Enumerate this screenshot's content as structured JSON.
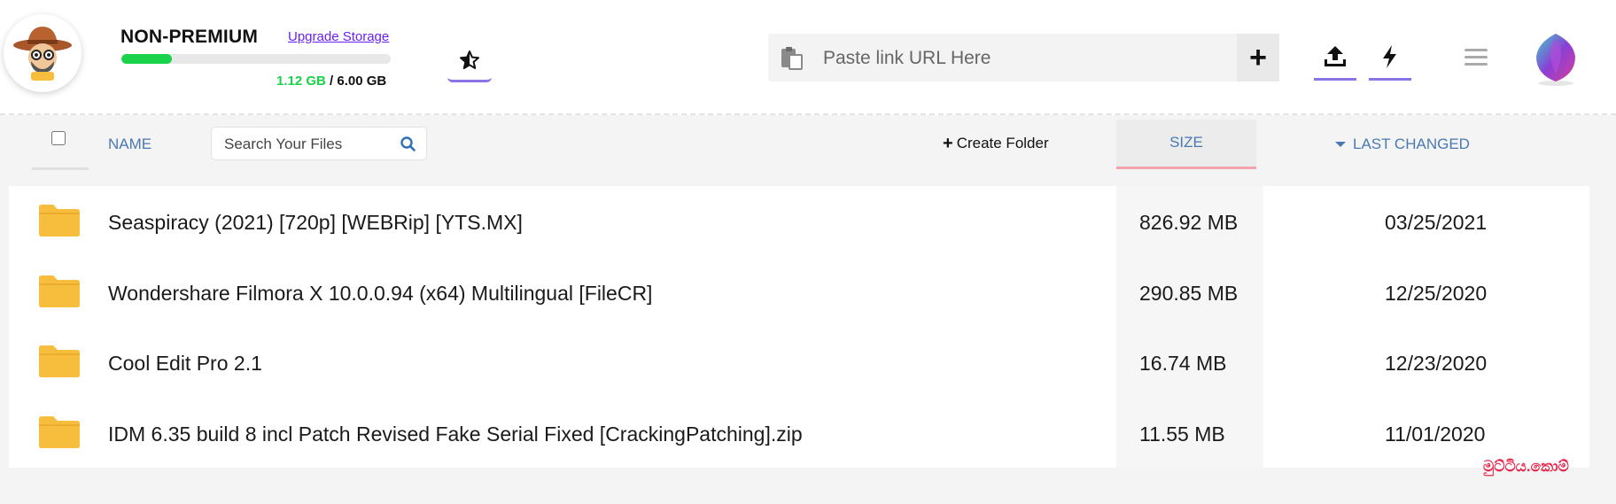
{
  "header": {
    "plan_label": "NON-PREMIUM",
    "upgrade_label": "Upgrade Storage",
    "storage_used": "1.12 GB",
    "storage_total": " / 6.00 GB",
    "storage_fraction": 0.187,
    "url_placeholder": "Paste link URL Here",
    "add_label": "+",
    "icons": [
      "user-avatar-icon",
      "star-icon",
      "clipboard-icon",
      "plus-icon",
      "upload-icon",
      "lightning-icon",
      "menu-icon",
      "logo-icon"
    ]
  },
  "toolbar": {
    "name_label": "NAME",
    "search_placeholder": "Search Your Files",
    "create_folder_label": "Create Folder",
    "size_label": "SIZE",
    "last_changed_label": "LAST CHANGED"
  },
  "files": [
    {
      "name": "Seaspiracy (2021) [720p] [WEBRip] [YTS.MX]",
      "size": "826.92 MB",
      "date": "03/25/2021"
    },
    {
      "name": "Wondershare Filmora X 10.0.0.94 (x64) Multilingual [FileCR]",
      "size": "290.85 MB",
      "date": "12/25/2020"
    },
    {
      "name": "Cool Edit Pro 2.1",
      "size": "16.74 MB",
      "date": "12/23/2020"
    },
    {
      "name": "IDM 6.35 build 8 incl Patch Revised Fake Serial Fixed [CrackingPatching].zip",
      "size": "11.55 MB",
      "date": "11/01/2020"
    }
  ],
  "watermark": "මුට්ටිය.කොම්",
  "colors": {
    "accent": "#8a74e6",
    "storage_green": "#19d34a",
    "link_purple": "#6a1ff0",
    "column_blue": "#4a79b0",
    "size_underline": "#f2a3ae",
    "folder_yellow": "#f7bd3c",
    "watermark_red": "#e6284e"
  }
}
